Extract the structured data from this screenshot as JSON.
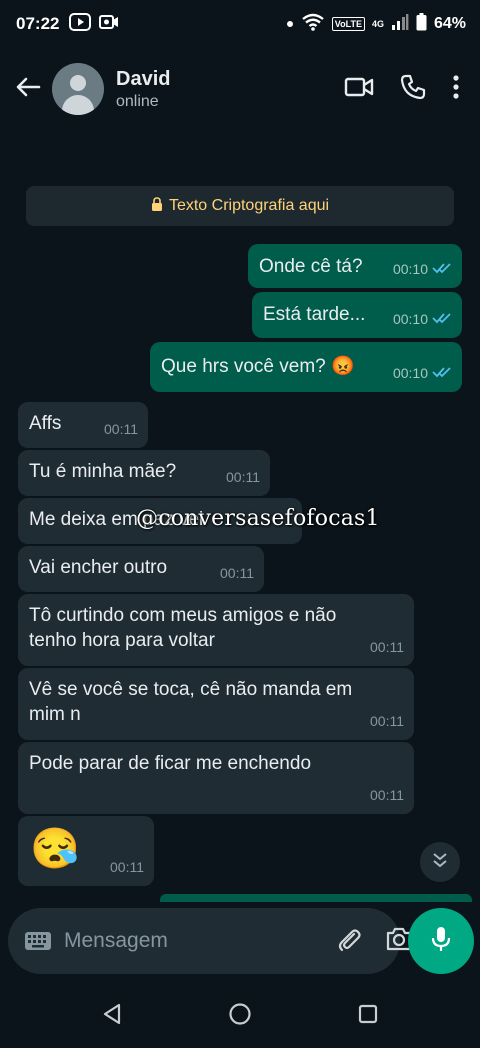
{
  "status_bar": {
    "time": "07:22",
    "battery": "64%",
    "network": "4G",
    "volte": "VoLTE"
  },
  "header": {
    "contact_name": "David",
    "contact_status": "online"
  },
  "encryption_notice": "Texto Criptografia aqui",
  "messages": [
    {
      "direction": "out",
      "text": "Onde cê tá?",
      "time": "00:10",
      "read": true
    },
    {
      "direction": "out",
      "text": "Está tarde...",
      "time": "00:10",
      "read": true
    },
    {
      "direction": "out",
      "text": "Que hrs você vem? 😡",
      "time": "00:10",
      "read": true
    },
    {
      "direction": "in",
      "text": "Affs",
      "time": "00:11"
    },
    {
      "direction": "in",
      "text": "Tu é minha mãe?",
      "time": "00:11"
    },
    {
      "direction": "in",
      "text": "Me deixa em paz vei",
      "time": ""
    },
    {
      "direction": "in",
      "text": "Vai encher outro",
      "time": "00:11"
    },
    {
      "direction": "in",
      "text": "Tô curtindo com meus amigos e não tenho hora para voltar",
      "time": "00:11"
    },
    {
      "direction": "in",
      "text": "Vê se você se toca, cê não manda em mim n",
      "time": "00:11"
    },
    {
      "direction": "in",
      "text": "Pode parar de ficar me enchendo",
      "time": "00:11"
    },
    {
      "direction": "in",
      "text": "😪",
      "time": "00:11"
    }
  ],
  "watermark": "@conversasefofocas1",
  "composer": {
    "placeholder": "Mensagem"
  },
  "colors": {
    "background": "#0b141a",
    "outgoing_bubble": "#005c4b",
    "incoming_bubble": "#1f2c34",
    "accent": "#00a884",
    "read_tick": "#53bdeb",
    "encryption_text": "#ffd279"
  },
  "icons": {
    "status_left": [
      "youtube-icon",
      "screen-record-icon"
    ],
    "status_right": [
      "dot-icon",
      "wifi-icon",
      "signal-icon",
      "battery-icon"
    ],
    "header": [
      "back-arrow-icon",
      "video-call-icon",
      "phone-icon",
      "more-vert-icon"
    ],
    "composer": [
      "keyboard-icon",
      "attach-icon",
      "camera-icon",
      "mic-icon"
    ],
    "nav": [
      "nav-back-icon",
      "nav-home-icon",
      "nav-recents-icon"
    ]
  }
}
